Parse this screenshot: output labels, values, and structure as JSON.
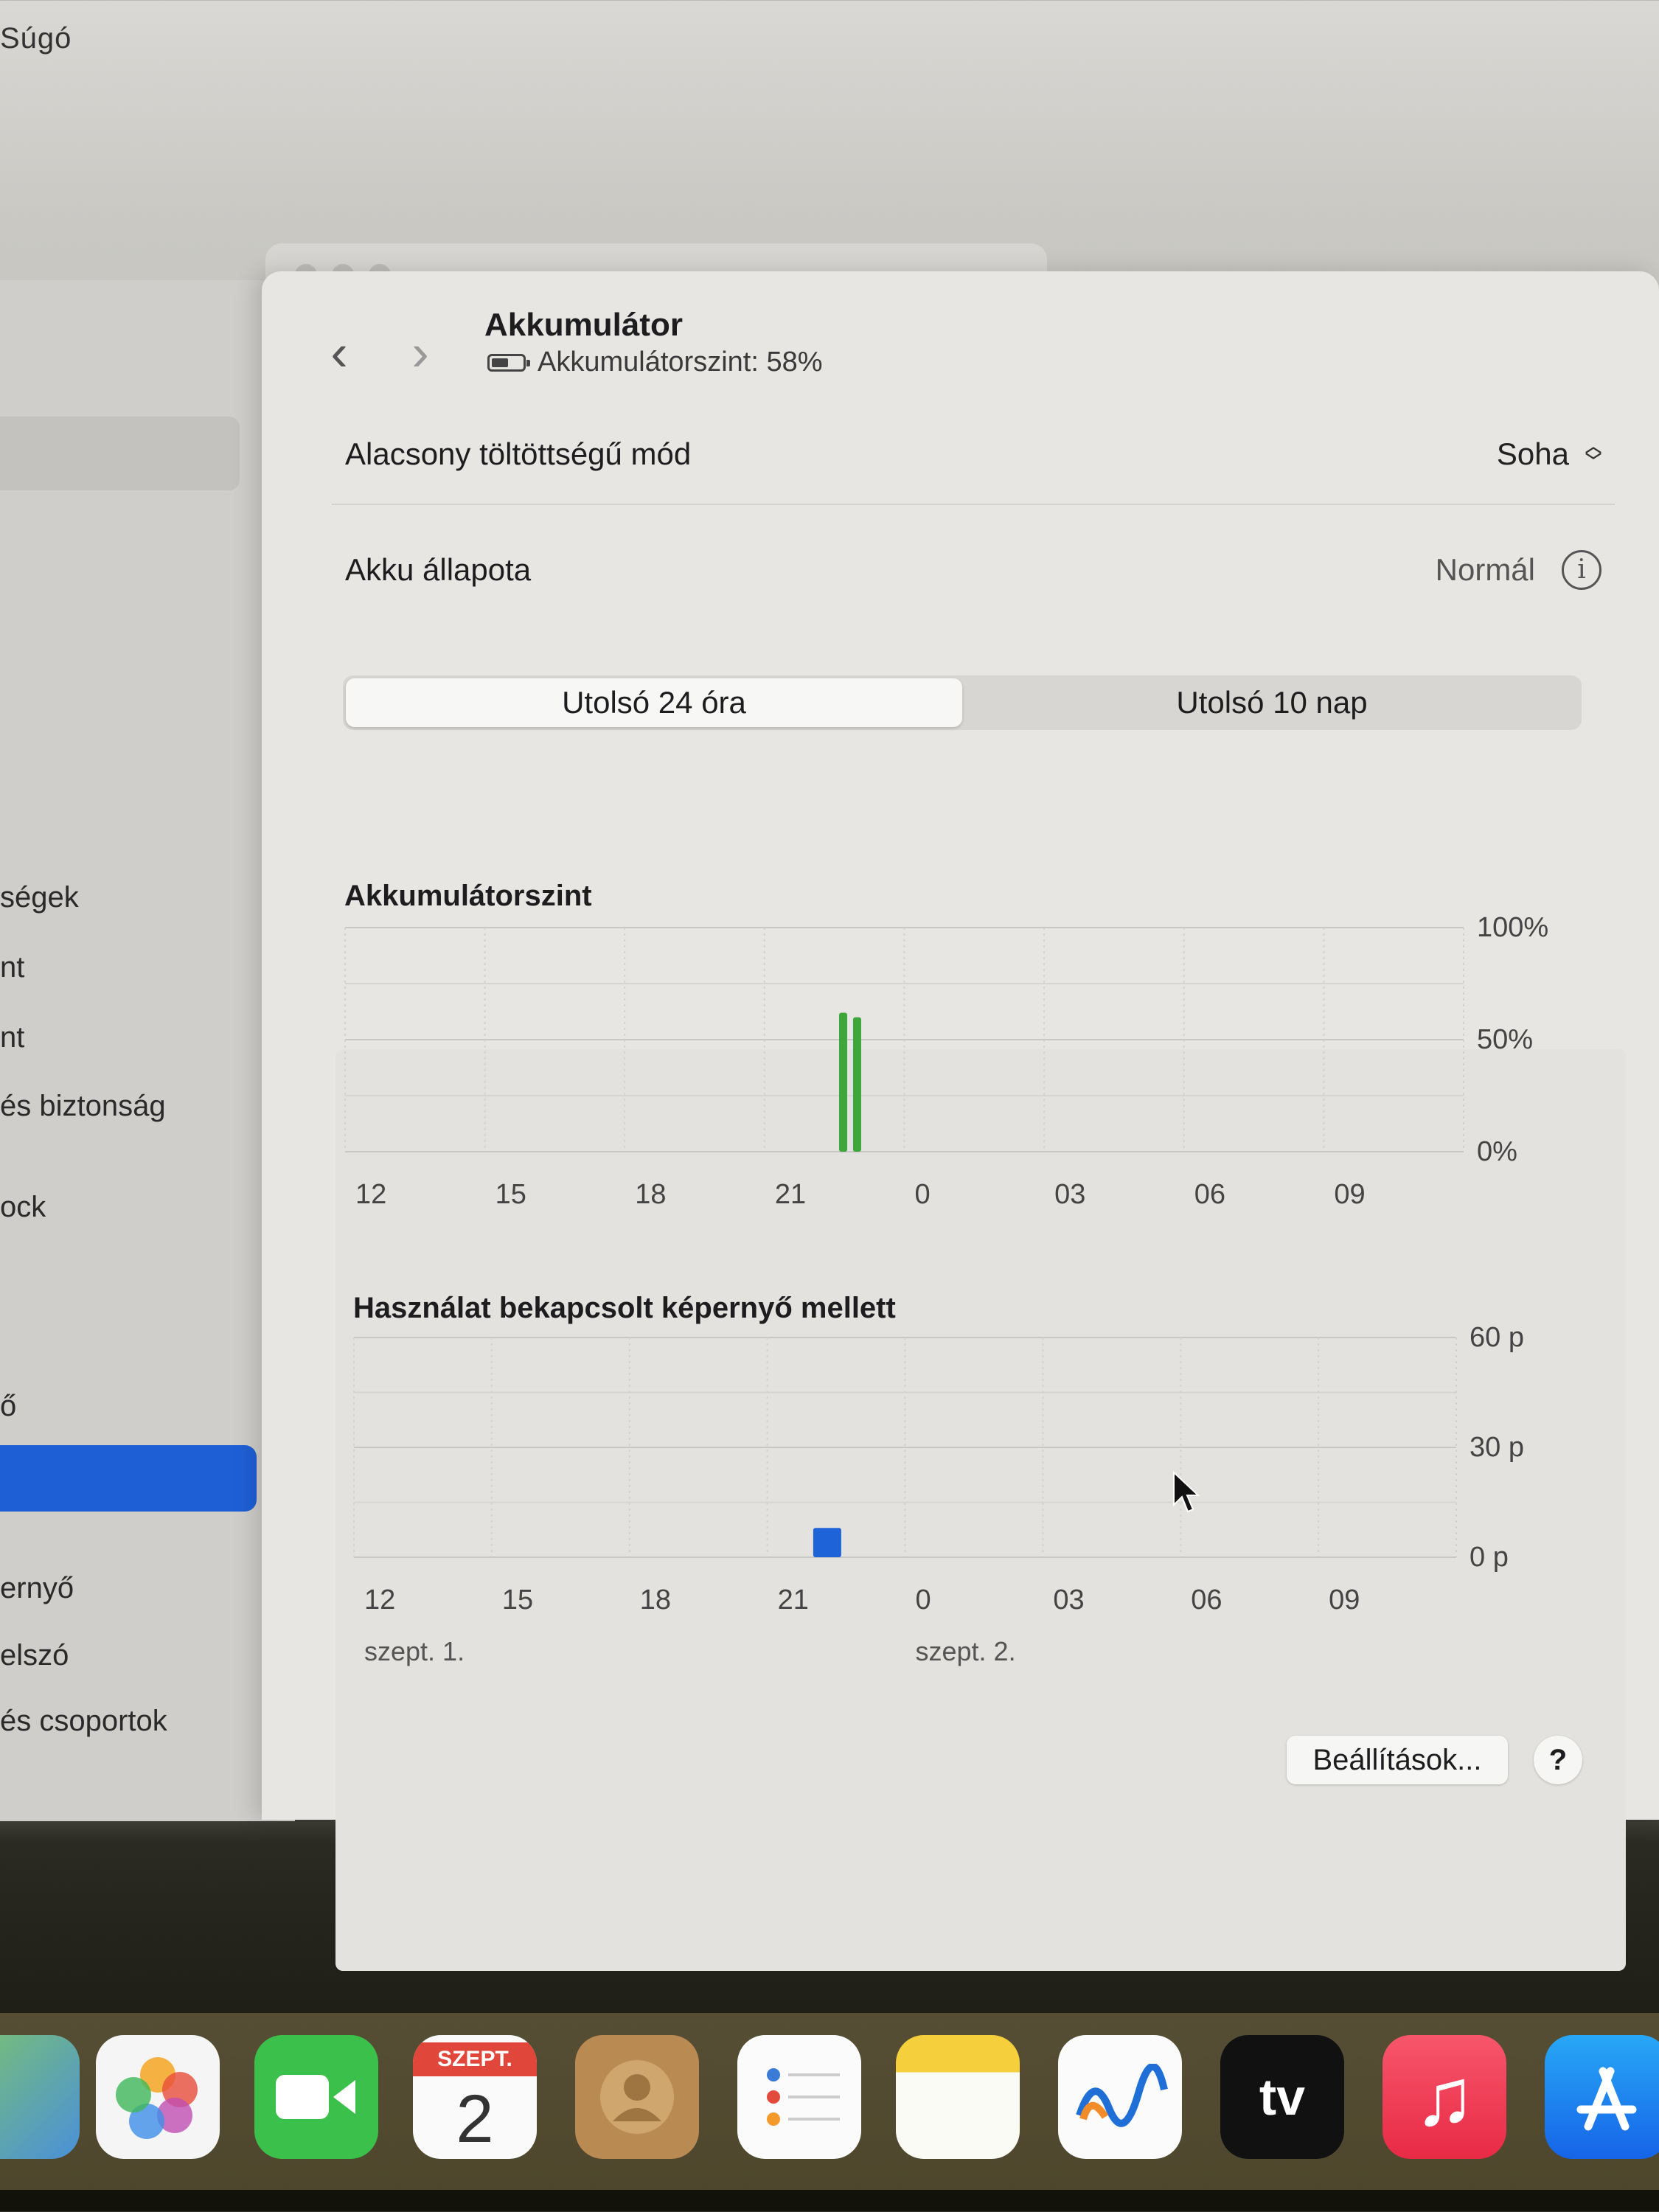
{
  "menubar": {
    "text": "Súgó"
  },
  "sidebar": {
    "items": [
      {
        "label": "ségek"
      },
      {
        "label": "nt"
      },
      {
        "label": "nt"
      },
      {
        "label": "és biztonság"
      },
      {
        "label": "ock"
      },
      {
        "label": "ő"
      },
      {
        "label": "ernyő"
      },
      {
        "label": "elszó"
      },
      {
        "label": "és csoportok"
      }
    ]
  },
  "header": {
    "back": "‹",
    "forward": "›",
    "title": "Akkumulátor",
    "subtitle": "Akkumulátorszint: 58%"
  },
  "rows": {
    "low_power": {
      "label": "Alacsony töltöttségű mód",
      "value": "Soha"
    },
    "health": {
      "label": "Akku állapota",
      "value": "Normál"
    }
  },
  "segments": [
    "Utolsó 24 óra",
    "Utolsó 10 nap"
  ],
  "chart_data": [
    {
      "type": "bar",
      "title": "Akkumulátorszint",
      "categories": [
        "12",
        "15",
        "18",
        "21",
        "0",
        "03",
        "06",
        "09"
      ],
      "y_ticks": [
        "100%",
        "50%",
        "0%"
      ],
      "ylim": [
        0,
        100
      ],
      "bars": [
        {
          "hour": 10.6,
          "value": 62
        },
        {
          "hour": 10.9,
          "value": 60
        }
      ],
      "colors": {
        "bar": "#3fa63c"
      }
    },
    {
      "type": "bar",
      "title": "Használat bekapcsolt képernyő mellett",
      "categories": [
        "12",
        "15",
        "18",
        "21",
        "0",
        "03",
        "06",
        "09"
      ],
      "date_labels": [
        "szept. 1.",
        "szept. 2."
      ],
      "y_ticks": [
        "60 p",
        "30 p",
        "0 p"
      ],
      "ylim": [
        0,
        60
      ],
      "bars": [
        {
          "hour": 10.0,
          "value": 8
        }
      ],
      "colors": {
        "bar": "#1f63d8"
      }
    }
  ],
  "footer": {
    "settings_label": "Beállítások...",
    "help_label": "?"
  },
  "dock": {
    "calendar_month": "SZEPT.",
    "calendar_day": "2",
    "tv_label": "tv",
    "icons": [
      "maps-icon",
      "photos-icon",
      "facetime-icon",
      "calendar-icon",
      "contacts-icon",
      "reminders-icon",
      "notes-icon",
      "freeform-icon",
      "tv-icon",
      "music-icon",
      "app-store-icon"
    ]
  }
}
